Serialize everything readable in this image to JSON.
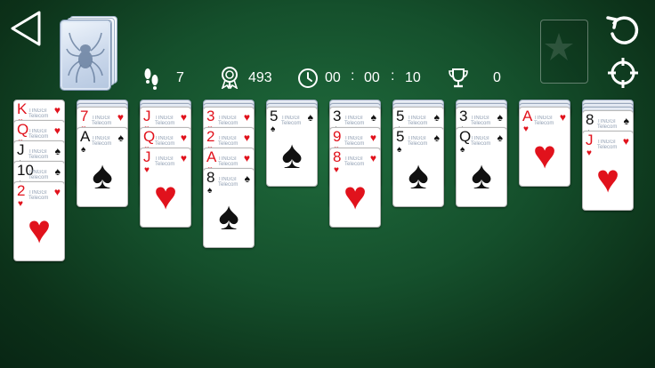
{
  "stats": {
    "moves": "7",
    "score": "493",
    "time_h": "00",
    "time_m": "00",
    "time_s": "10",
    "time_sep": ":",
    "trophies": "0"
  },
  "icons": {
    "back": "back-arrow-icon",
    "undo": "undo-icon",
    "hint": "crosshair-icon",
    "moves": "footprints-icon",
    "score": "award-icon",
    "time": "clock-icon",
    "trophies": "trophy-icon"
  },
  "card_brand": "TINGGI Telecom",
  "colors": {
    "red": "#e1121c",
    "black": "#111111",
    "felt": "#15502c"
  },
  "tableau": [
    {
      "facedown": 0,
      "cards": [
        {
          "rank": "K",
          "suit": "♥",
          "color": "red"
        },
        {
          "rank": "Q",
          "suit": "♥",
          "color": "red"
        },
        {
          "rank": "J",
          "suit": "♠",
          "color": "black"
        },
        {
          "rank": "10",
          "suit": "♠",
          "color": "black"
        },
        {
          "rank": "2",
          "suit": "♥",
          "color": "red"
        }
      ]
    },
    {
      "facedown": 2,
      "cards": [
        {
          "rank": "7",
          "suit": "♥",
          "color": "red"
        },
        {
          "rank": "A",
          "suit": "♠",
          "color": "black"
        }
      ]
    },
    {
      "facedown": 2,
      "cards": [
        {
          "rank": "J",
          "suit": "♥",
          "color": "red"
        },
        {
          "rank": "Q",
          "suit": "♥",
          "color": "red"
        },
        {
          "rank": "J",
          "suit": "♥",
          "color": "red"
        }
      ]
    },
    {
      "facedown": 2,
      "cards": [
        {
          "rank": "3",
          "suit": "♥",
          "color": "red"
        },
        {
          "rank": "2",
          "suit": "♥",
          "color": "red"
        },
        {
          "rank": "A",
          "suit": "♥",
          "color": "red"
        },
        {
          "rank": "8",
          "suit": "♠",
          "color": "black"
        }
      ]
    },
    {
      "facedown": 2,
      "cards": [
        {
          "rank": "5",
          "suit": "♠",
          "color": "black"
        }
      ]
    },
    {
      "facedown": 2,
      "cards": [
        {
          "rank": "3",
          "suit": "♠",
          "color": "black"
        },
        {
          "rank": "9",
          "suit": "♥",
          "color": "red"
        },
        {
          "rank": "8",
          "suit": "♥",
          "color": "red"
        }
      ]
    },
    {
      "facedown": 2,
      "cards": [
        {
          "rank": "5",
          "suit": "♠",
          "color": "black"
        },
        {
          "rank": "5",
          "suit": "♠",
          "color": "black"
        }
      ]
    },
    {
      "facedown": 2,
      "cards": [
        {
          "rank": "3",
          "suit": "♠",
          "color": "black"
        },
        {
          "rank": "Q",
          "suit": "♠",
          "color": "black"
        }
      ]
    },
    {
      "facedown": 2,
      "cards": [
        {
          "rank": "A",
          "suit": "♥",
          "color": "red"
        }
      ]
    },
    {
      "facedown": 3,
      "cards": [
        {
          "rank": "8",
          "suit": "♠",
          "color": "black"
        },
        {
          "rank": "J",
          "suit": "♥",
          "color": "red"
        }
      ]
    }
  ]
}
